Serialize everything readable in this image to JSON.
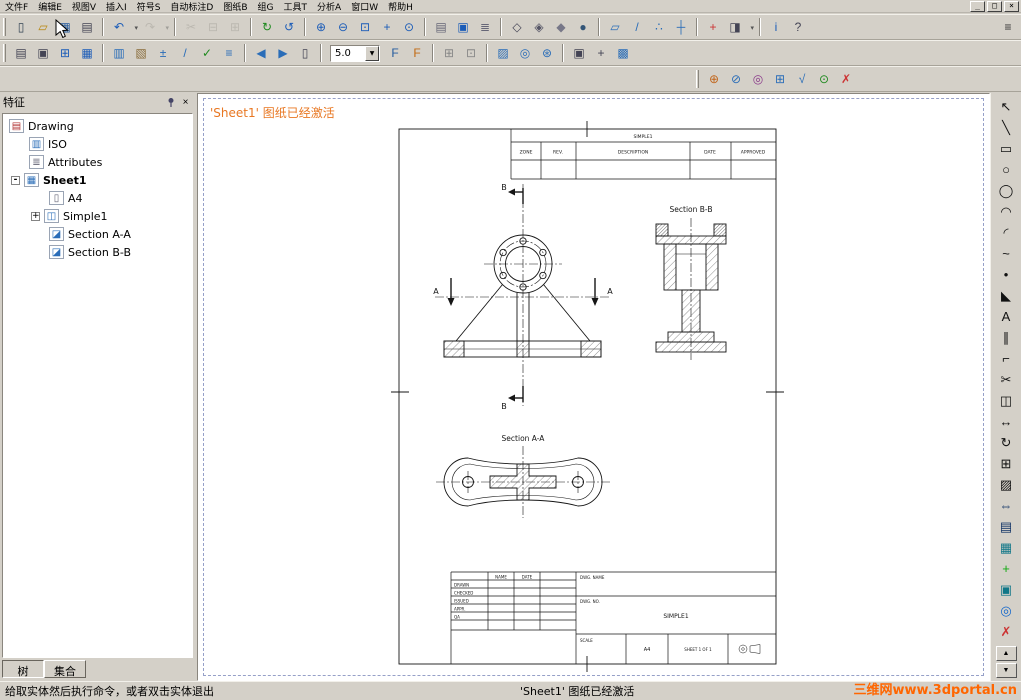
{
  "window": {
    "controls": [
      {
        "name": "minimize-button",
        "glyph": "_"
      },
      {
        "name": "maximize-button",
        "glyph": "□"
      },
      {
        "name": "close-button",
        "glyph": "×"
      }
    ]
  },
  "menu": {
    "items": [
      {
        "label": "文件F"
      },
      {
        "label": "编辑E"
      },
      {
        "label": "视图V"
      },
      {
        "label": "插入I"
      },
      {
        "label": "符号S"
      },
      {
        "label": "自动标注D"
      },
      {
        "label": "图纸B"
      },
      {
        "label": "组G"
      },
      {
        "label": "工具T"
      },
      {
        "label": "分析A"
      },
      {
        "label": "窗口W"
      },
      {
        "label": "帮助H"
      }
    ]
  },
  "toolbars": {
    "row1": [
      {
        "name": "new-file-button",
        "glyph": "▯",
        "color": "#345"
      },
      {
        "name": "open-file-button",
        "glyph": "▱",
        "color": "#b8860b"
      },
      {
        "name": "save-button",
        "glyph": "▦",
        "color": "#235a9e"
      },
      {
        "name": "print-button",
        "glyph": "▤",
        "color": "#445"
      },
      {
        "type": "sep"
      },
      {
        "name": "undo-button",
        "glyph": "↶",
        "color": "#1b5cb8",
        "dd": true
      },
      {
        "name": "redo-button",
        "glyph": "↷",
        "color": "#98958d",
        "dd": true,
        "disabled": true
      },
      {
        "type": "sep"
      },
      {
        "name": "cut-button",
        "glyph": "✂",
        "color": "#98958d",
        "disabled": true
      },
      {
        "name": "copy-button",
        "glyph": "⊟",
        "color": "#98958d",
        "disabled": true
      },
      {
        "name": "paste-button",
        "glyph": "⊞",
        "color": "#98958d",
        "disabled": true
      },
      {
        "type": "sep"
      },
      {
        "name": "regenerate-button",
        "glyph": "↻",
        "color": "#1f8a1f"
      },
      {
        "name": "repaint-button",
        "glyph": "↺",
        "color": "#1b5cb8"
      },
      {
        "type": "sep"
      },
      {
        "name": "zoom-in-button",
        "glyph": "⊕",
        "color": "#1b5cb8"
      },
      {
        "name": "zoom-out-button",
        "glyph": "⊖",
        "color": "#1b5cb8"
      },
      {
        "name": "refit-button",
        "glyph": "⊡",
        "color": "#1b5cb8"
      },
      {
        "name": "pan-button",
        "glyph": "+",
        "color": "#1b5cb8"
      },
      {
        "name": "zoom-window-button",
        "glyph": "⊙",
        "color": "#1b5cb8"
      },
      {
        "type": "sep"
      },
      {
        "name": "layers-button",
        "glyph": "▤",
        "color": "#667"
      },
      {
        "name": "view-manager-button",
        "glyph": "▣",
        "color": "#1b5cb8"
      },
      {
        "name": "model-tree-button",
        "glyph": "≣",
        "color": "#667"
      },
      {
        "type": "sep"
      },
      {
        "name": "wireframe-button",
        "glyph": "◇",
        "color": "#445"
      },
      {
        "name": "hidden-line-button",
        "glyph": "◈",
        "color": "#556"
      },
      {
        "name": "no-hidden-button",
        "glyph": "◆",
        "color": "#778"
      },
      {
        "name": "shaded-button",
        "glyph": "●",
        "color": "#357"
      },
      {
        "type": "sep"
      },
      {
        "name": "datum-planes-toggle",
        "glyph": "▱",
        "color": "#2a6db8"
      },
      {
        "name": "datum-axes-toggle",
        "glyph": "/",
        "color": "#2a6db8"
      },
      {
        "name": "datum-points-toggle",
        "glyph": "∴",
        "color": "#2a6db8"
      },
      {
        "name": "datum-csys-toggle",
        "glyph": "┼",
        "color": "#2a6db8"
      },
      {
        "type": "sep"
      },
      {
        "name": "spin-center-button",
        "glyph": "+",
        "color": "#c33"
      },
      {
        "name": "orient-button",
        "glyph": "◨",
        "color": "#445",
        "dd": true
      },
      {
        "type": "sep"
      },
      {
        "name": "info-button",
        "glyph": "i",
        "color": "#1b5cb8"
      },
      {
        "name": "help-button",
        "glyph": "?",
        "color": "#445"
      },
      {
        "name": "toolbar-options-button",
        "glyph": "≡",
        "color": "#333",
        "push": true
      }
    ],
    "row2": [
      {
        "name": "sheet-setup-button",
        "glyph": "▤",
        "color": "#445"
      },
      {
        "name": "drawing-models-button",
        "glyph": "▣",
        "color": "#445"
      },
      {
        "name": "insert-view-button",
        "glyph": "⊞",
        "color": "#1b5cb8"
      },
      {
        "name": "insert-table-button",
        "glyph": "▦",
        "color": "#1b5cb8"
      },
      {
        "type": "sep"
      },
      {
        "name": "show-annotations-button",
        "glyph": "▥",
        "color": "#2a6db8"
      },
      {
        "name": "erase-annotations-button",
        "glyph": "▧",
        "color": "#8a6d3b"
      },
      {
        "name": "show-dimensions-button",
        "glyph": "±",
        "color": "#2a6db8"
      },
      {
        "name": "show-axes-button",
        "glyph": "/",
        "color": "#2a6db8"
      },
      {
        "name": "clean-dimensions-button",
        "glyph": "✓",
        "color": "#1f8a1f"
      },
      {
        "name": "align-dimensions-button",
        "glyph": "≡",
        "color": "#2a6db8"
      },
      {
        "type": "sep"
      },
      {
        "name": "previous-sheet-button",
        "glyph": "◀",
        "color": "#2a6db8"
      },
      {
        "name": "next-sheet-button",
        "glyph": "▶",
        "color": "#2a6db8"
      },
      {
        "name": "go-to-sheet-button",
        "glyph": "▯",
        "color": "#445"
      },
      {
        "type": "sep"
      },
      {
        "type": "combo",
        "name": "value-combo",
        "value": "5.0",
        "arrow": "▼"
      },
      {
        "name": "text-style-button",
        "glyph": "F",
        "color": "#235a9e"
      },
      {
        "name": "flag-note-button",
        "glyph": "F",
        "color": "#c26a12"
      },
      {
        "type": "sep"
      },
      {
        "name": "grid-toggle",
        "glyph": "⊞",
        "color": "#888"
      },
      {
        "name": "snap-toggle",
        "glyph": "⊡",
        "color": "#888"
      },
      {
        "type": "sep"
      },
      {
        "name": "hatch-edit-button",
        "glyph": "▨",
        "color": "#2a6db8"
      },
      {
        "name": "balloon-button",
        "glyph": "◎",
        "color": "#2a6db8"
      },
      {
        "name": "symbol-button",
        "glyph": "⊛",
        "color": "#2a6db8"
      },
      {
        "type": "sep"
      },
      {
        "name": "lock-view-toggle",
        "glyph": "▣",
        "color": "#445"
      },
      {
        "name": "move-view-button",
        "glyph": "+",
        "color": "#445"
      },
      {
        "name": "repeat-region-button",
        "glyph": "▩",
        "color": "#2a6db8"
      }
    ],
    "row3": [
      {
        "name": "dimension-new-button",
        "glyph": "⊕",
        "color": "#c2651a"
      },
      {
        "name": "ordinate-dimension-button",
        "glyph": "⊘",
        "color": "#2a6db8"
      },
      {
        "name": "reference-dimension-button",
        "glyph": "◎",
        "color": "#8b3a8b"
      },
      {
        "name": "geometric-tolerance-button",
        "glyph": "⊞",
        "color": "#2a6db8"
      },
      {
        "name": "surface-finish-button",
        "glyph": "√",
        "color": "#2a6db8"
      },
      {
        "name": "datum-target-button",
        "glyph": "⊙",
        "color": "#1f8a1f"
      },
      {
        "name": "delete-annotation-button",
        "glyph": "✗",
        "color": "#c33"
      }
    ]
  },
  "panel": {
    "title": "特征",
    "close_glyph": "×",
    "icon_glyphs": {
      "drawing": "▤",
      "iso": "▥",
      "attributes": "≣",
      "sheet": "▦",
      "a4": "▯",
      "view": "◫",
      "section": "◪"
    },
    "tree": [
      {
        "label": "Drawing",
        "level": 0,
        "icon": "drawing"
      },
      {
        "label": "ISO",
        "level": 1,
        "icon": "iso"
      },
      {
        "label": "Attributes",
        "level": 1,
        "icon": "attributes"
      },
      {
        "label": "Sheet1",
        "level": 1,
        "icon": "sheet",
        "bold": true,
        "expander": "-"
      },
      {
        "label": "A4",
        "level": 2,
        "icon": "a4"
      },
      {
        "label": "Simple1",
        "level": 2,
        "icon": "view",
        "expander": "+"
      },
      {
        "label": "Section A-A",
        "level": 2,
        "icon": "section"
      },
      {
        "label": "Section B-B",
        "level": 2,
        "icon": "section"
      }
    ],
    "tabs": [
      {
        "label": "树",
        "active": true
      },
      {
        "label": "集合",
        "active": false
      }
    ]
  },
  "canvas": {
    "message": "'Sheet1' 图纸已经激活",
    "sheet": {
      "labels": {
        "section_aa": "Section A-A",
        "section_bb": "Section B-B",
        "a": "A",
        "b": "B"
      },
      "rev_table": {
        "title": "SIMPLE1",
        "cols": [
          "ZONE",
          "REV.",
          "DESCRIPTION",
          "DATE",
          "APPROVED"
        ]
      },
      "title_block": {
        "header_cols": [
          "NAME",
          "DATE"
        ],
        "rows": [
          "DRAWN",
          "CHECKED",
          "ISSUED",
          "APPR.",
          "QA"
        ],
        "dwg_name_label": "DWG. NAME",
        "dwg_no_label": "DWG. NO.",
        "dwg_no_value": "SIMPLE1",
        "scale_label": "SCALE",
        "size_value": "A4",
        "sheet_label": "SHEET 1 OF 1"
      }
    }
  },
  "palette": {
    "tools": [
      {
        "name": "select-tool",
        "glyph": "↖",
        "color": "#111"
      },
      {
        "name": "line-tool",
        "glyph": "╲",
        "color": "#111"
      },
      {
        "name": "rectangle-tool",
        "glyph": "▭",
        "color": "#111"
      },
      {
        "name": "circle-tool",
        "glyph": "○",
        "color": "#111"
      },
      {
        "name": "ellipse-tool",
        "glyph": "◯",
        "color": "#111"
      },
      {
        "name": "arc-tool",
        "glyph": "◠",
        "color": "#111"
      },
      {
        "name": "fillet-tool",
        "glyph": "◜",
        "color": "#111"
      },
      {
        "name": "spline-tool",
        "glyph": "~",
        "color": "#111"
      },
      {
        "name": "point-tool",
        "glyph": "•",
        "color": "#111"
      },
      {
        "name": "chamfer-tool",
        "glyph": "◣",
        "color": "#111"
      },
      {
        "name": "text-tool",
        "glyph": "A",
        "color": "#111"
      },
      {
        "name": "offset-tool",
        "glyph": "∥",
        "color": "#111"
      },
      {
        "name": "use-edge-tool",
        "glyph": "⌐",
        "color": "#111"
      },
      {
        "name": "trim-tool",
        "glyph": "✂",
        "color": "#111"
      },
      {
        "name": "mirror-tool",
        "glyph": "◫",
        "color": "#111"
      },
      {
        "name": "move-tool",
        "glyph": "↔",
        "color": "#111"
      },
      {
        "name": "rotate-tool",
        "glyph": "↻",
        "color": "#111"
      },
      {
        "name": "copy-tool",
        "glyph": "⊞",
        "color": "#111"
      },
      {
        "name": "hatch-tool",
        "glyph": "▨",
        "color": "#111"
      },
      {
        "name": "dimension-tool",
        "glyph": "⇔",
        "color": "#136"
      },
      {
        "name": "note-tool",
        "glyph": "▤",
        "color": "#136"
      },
      {
        "name": "table-tool",
        "glyph": "▦",
        "color": "#178"
      },
      {
        "name": "symbol-tool",
        "glyph": "+",
        "color": "#1a1"
      },
      {
        "name": "snapshot-tool",
        "glyph": "▣",
        "color": "#178"
      },
      {
        "name": "balloon-tool",
        "glyph": "◎",
        "color": "#16c"
      },
      {
        "name": "delete-tool",
        "glyph": "✗",
        "color": "#c33"
      }
    ],
    "scroll_up": "▲",
    "scroll_down": "▼"
  },
  "statusbar": {
    "left": "给取实体然后执行命令，或者双击实体退出",
    "center": "'Sheet1' 图纸已经激活",
    "watermark": "三维网www.3dportal.cn"
  }
}
